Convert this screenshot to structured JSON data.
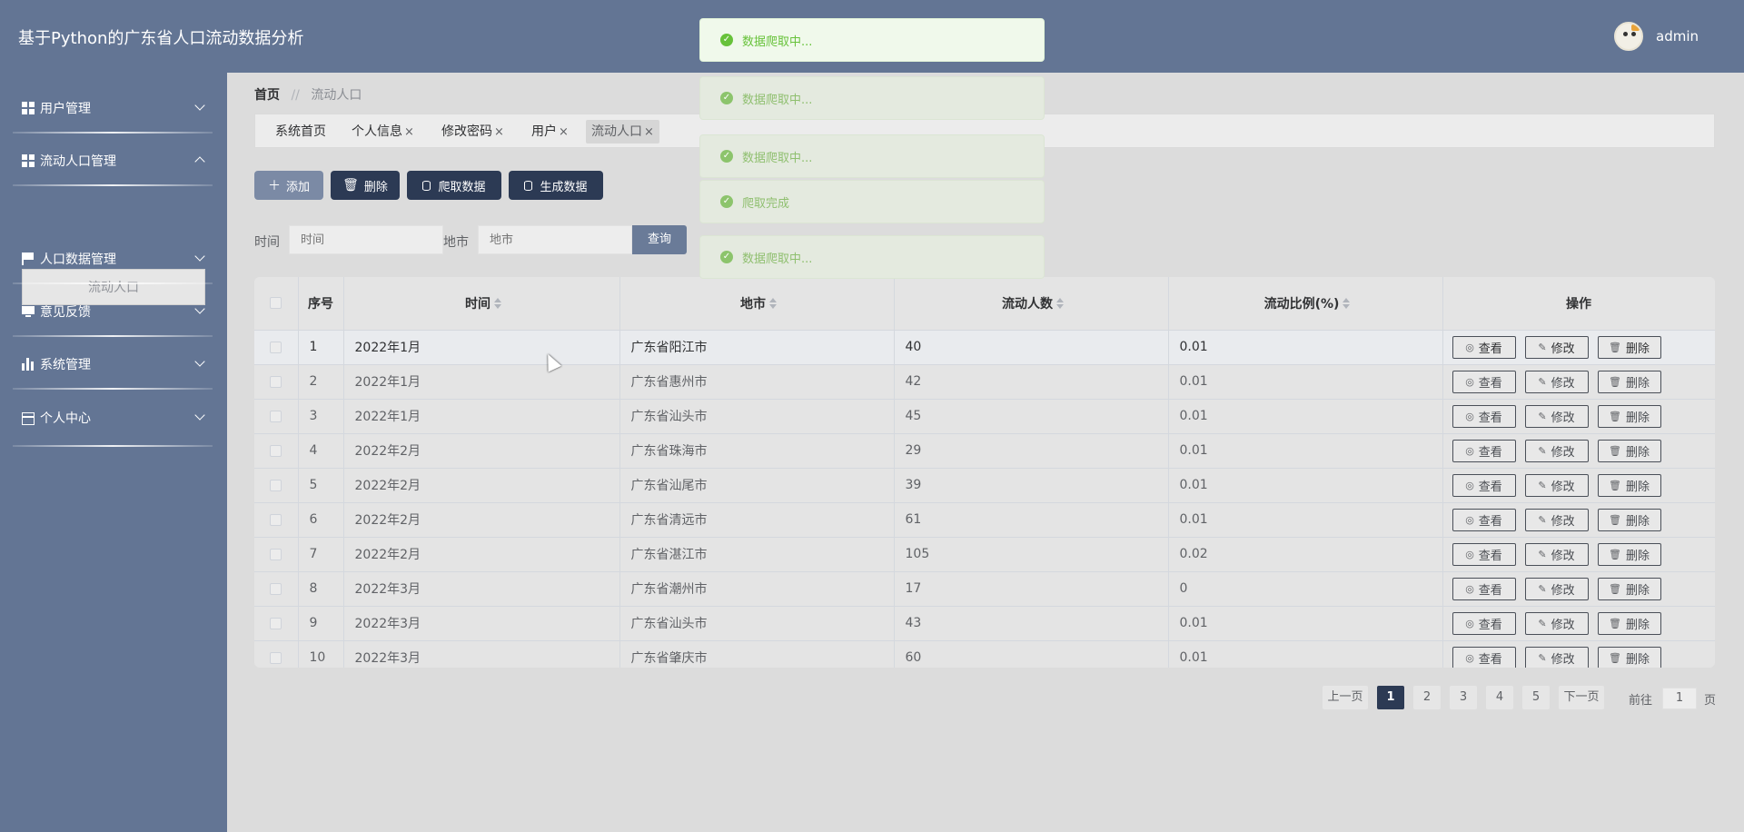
{
  "app": {
    "title": "基于Python的广东省人口流动数据分析"
  },
  "user": {
    "name": "admin"
  },
  "sidebar": {
    "items": [
      {
        "label": "用户管理",
        "icon": "grid-icon"
      },
      {
        "label": "流动人口管理",
        "icon": "grid-icon",
        "expanded": true,
        "sub": [
          "流动人口"
        ]
      },
      {
        "label": "人口数据管理",
        "icon": "flag-icon"
      },
      {
        "label": "意见反馈",
        "icon": "monitor-icon"
      },
      {
        "label": "系统管理",
        "icon": "bar-chart-icon"
      },
      {
        "label": "个人中心",
        "icon": "card-icon"
      }
    ]
  },
  "breadcrumb": {
    "home": "首页",
    "separator": "//",
    "current": "流动人口"
  },
  "tabs": [
    "系统首页",
    "个人信息",
    "修改密码",
    "用户",
    "流动人口"
  ],
  "tab_close": "×",
  "toolbar": {
    "add": "添加",
    "delete": "删除",
    "crawl": "爬取数据",
    "generate": "生成数据"
  },
  "search": {
    "time_label": "时间",
    "time_placeholder": "时间",
    "city_label": "地市",
    "city_placeholder": "地市",
    "button": "查询"
  },
  "table": {
    "columns": [
      "序号",
      "时间",
      "地市",
      "流动人数",
      "流动比例(%)",
      "操作"
    ],
    "rows": [
      [
        "1",
        "2022年1月",
        "广东省阳江市",
        "40",
        "0.01"
      ],
      [
        "2",
        "2022年1月",
        "广东省惠州市",
        "42",
        "0.01"
      ],
      [
        "3",
        "2022年1月",
        "广东省汕头市",
        "45",
        "0.01"
      ],
      [
        "4",
        "2022年2月",
        "广东省珠海市",
        "29",
        "0.01"
      ],
      [
        "5",
        "2022年2月",
        "广东省汕尾市",
        "39",
        "0.01"
      ],
      [
        "6",
        "2022年2月",
        "广东省清远市",
        "61",
        "0.01"
      ],
      [
        "7",
        "2022年2月",
        "广东省湛江市",
        "105",
        "0.02"
      ],
      [
        "8",
        "2022年3月",
        "广东省潮州市",
        "17",
        "0"
      ],
      [
        "9",
        "2022年3月",
        "广东省汕头市",
        "43",
        "0.01"
      ],
      [
        "10",
        "2022年3月",
        "广东省肇庆市",
        "60",
        "0.01"
      ]
    ],
    "actions": {
      "view": "查看",
      "edit": "修改",
      "delete": "删除"
    }
  },
  "pagination": {
    "prev": "上一页",
    "pages": [
      "1",
      "2",
      "3",
      "4",
      "5"
    ],
    "current": "1",
    "next": "下一页",
    "goto_label": "前往",
    "goto_value": "1",
    "page_unit": "页"
  },
  "toasts": [
    "数据爬取中...",
    "数据爬取中...",
    "数据爬取中...",
    "爬取完成",
    "数据爬取中..."
  ],
  "colors": {
    "header": "#637594",
    "accent": "#2c3a54",
    "success": "#67c23a"
  }
}
